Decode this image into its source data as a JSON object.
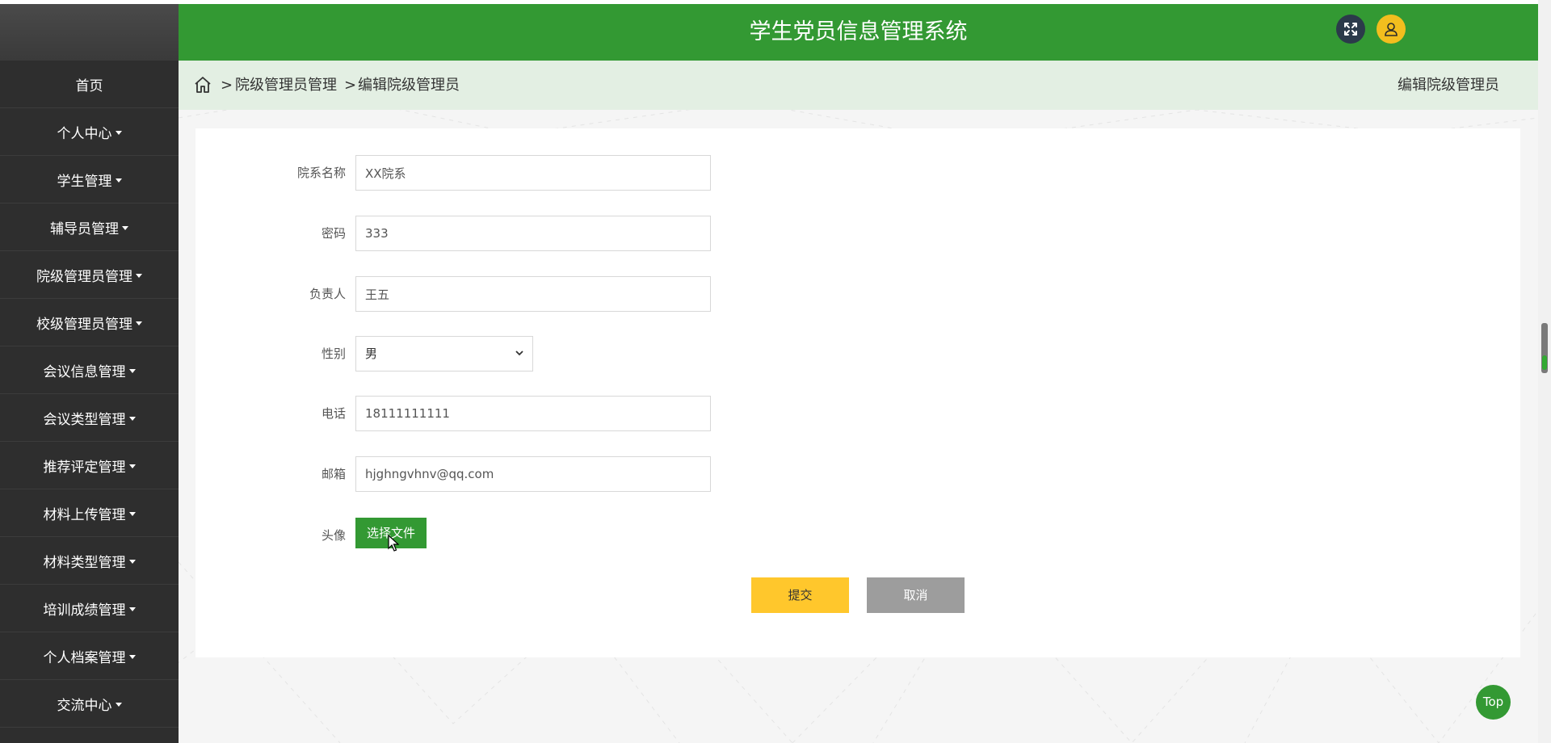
{
  "app": {
    "title": "学生党员信息管理系统"
  },
  "header": {
    "fullscreen_icon": "expand-icon",
    "user_icon": "user-icon"
  },
  "sidebar": {
    "items": [
      {
        "label": "首页",
        "has_caret": false
      },
      {
        "label": "个人中心",
        "has_caret": true
      },
      {
        "label": "学生管理",
        "has_caret": true
      },
      {
        "label": "辅导员管理",
        "has_caret": true
      },
      {
        "label": "院级管理员管理",
        "has_caret": true
      },
      {
        "label": "校级管理员管理",
        "has_caret": true
      },
      {
        "label": "会议信息管理",
        "has_caret": true
      },
      {
        "label": "会议类型管理",
        "has_caret": true
      },
      {
        "label": "推荐评定管理",
        "has_caret": true
      },
      {
        "label": "材料上传管理",
        "has_caret": true
      },
      {
        "label": "材料类型管理",
        "has_caret": true
      },
      {
        "label": "培训成绩管理",
        "has_caret": true
      },
      {
        "label": "个人档案管理",
        "has_caret": true
      },
      {
        "label": "交流中心",
        "has_caret": true
      }
    ]
  },
  "breadcrumb": {
    "separator": ">",
    "items": [
      "院级管理员管理",
      "编辑院级管理员"
    ],
    "page_title": "编辑院级管理员"
  },
  "form": {
    "fields": {
      "department": {
        "label": "院系名称",
        "value": "XX院系"
      },
      "password": {
        "label": "密码",
        "value": "333"
      },
      "leader": {
        "label": "负责人",
        "value": "王五"
      },
      "gender": {
        "label": "性别",
        "value": "男"
      },
      "phone": {
        "label": "电话",
        "value": "18111111111"
      },
      "email": {
        "label": "邮箱",
        "value": "hjghngvhnv@qq.com"
      },
      "avatar": {
        "label": "头像",
        "button_label": "选择文件"
      }
    },
    "submit_label": "提交",
    "cancel_label": "取消"
  },
  "top_button_label": "Top",
  "colors": {
    "primary_green": "#339933",
    "sidebar_bg": "#2e2e2e",
    "breadcrumb_bg": "#e3efe3",
    "submit_yellow": "#ffc72c",
    "cancel_gray": "#9d9d9d",
    "user_avatar_yellow": "#f2be1e"
  }
}
